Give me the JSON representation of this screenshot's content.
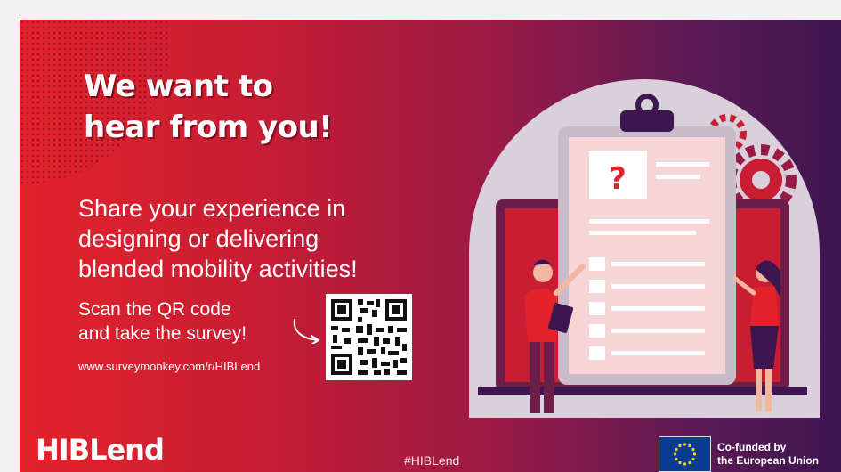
{
  "headline": {
    "line1": "We want to",
    "line2": "hear from you!"
  },
  "subtext": {
    "line1": "Share your experience in",
    "line2": "designing or delivering",
    "line3": "blended mobility activities!"
  },
  "cta": {
    "line1": "Scan the QR code",
    "line2": "and take the survey!"
  },
  "url": "www.surveymonkey.com/r/HIBLend",
  "logo": "HIBLend",
  "hashtag": "#HIBLend",
  "eu": {
    "line1": "Co-funded by",
    "line2": "the European Union"
  },
  "illustration": {
    "mark": "?"
  },
  "colors": {
    "red": "#e3232b",
    "purple": "#3d1650",
    "card": "#f6d5d6",
    "clipboard": "#c9bcc9"
  }
}
